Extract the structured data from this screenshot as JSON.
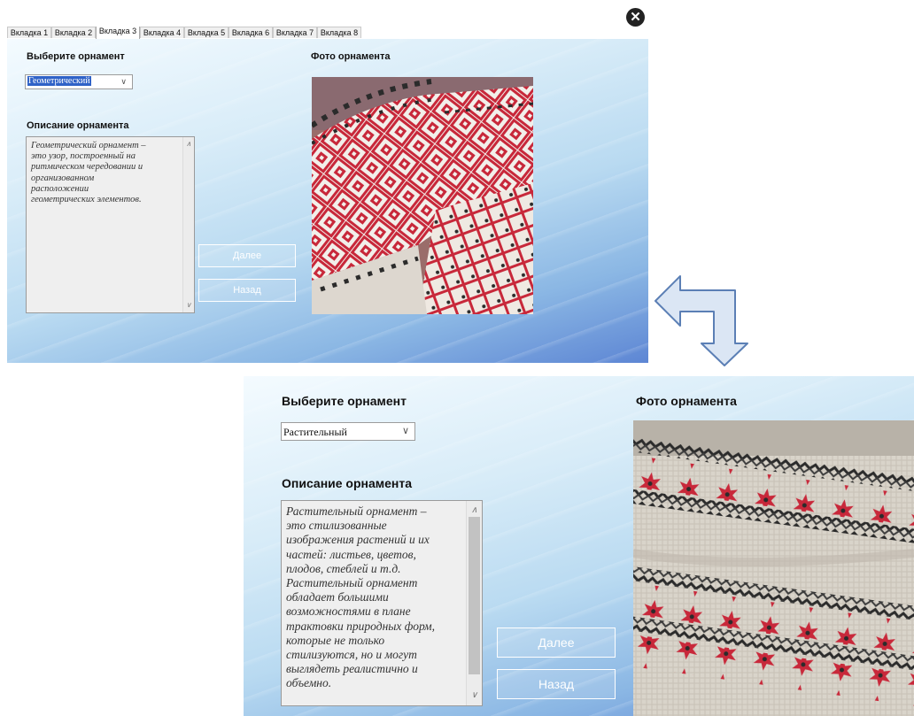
{
  "top_window": {
    "tabs": [
      "Вкладка 1",
      "Вкладка 2",
      "Вкладка 3",
      "Вкладка 4",
      "Вкладка 5",
      "Вкладка 6",
      "Вкладка 7",
      "Вкладка 8"
    ],
    "active_tab": 2,
    "select_label": "Выберите орнамент",
    "combo_value": "Геометрический",
    "description_label": "Описание орнамента",
    "description_lines": [
      "Геометрический орнамент –",
      "это узор, построенный на",
      "ритмическом чередовании и",
      "организованном",
      "расположении",
      "геометрических элементов."
    ],
    "photo_label": "Фото орнамента",
    "next_button": "Далее",
    "back_button": "Назад"
  },
  "bottom_window": {
    "select_label": "Выберите орнамент",
    "combo_value": "Растительный",
    "description_label": "Описание орнамента",
    "description_lines": [
      "Растительный орнамент –",
      "это стилизованные",
      "изображения растений и их",
      "частей: листьев, цветов,",
      "плодов, стеблей и т.д.",
      "Растительный орнамент",
      "обладает большими",
      "возможностями в плане",
      "трактовки природных форм,",
      "которые не только",
      "стилизуются, но и могут",
      "выглядеть реалистично и",
      "объемно."
    ],
    "photo_label": "Фото орнамента",
    "next_button": "Далее",
    "back_button": "Назад"
  },
  "icons": {
    "close": "close-icon",
    "combo_arrow": "chevron-down-icon",
    "transition": "transition-arrow-icon"
  },
  "colors": {
    "ornament_red": "#c8283a",
    "ornament_dark": "#2b2b2b",
    "linen": "#dcd8cf",
    "arrow_fill": "#dbe6f4",
    "arrow_stroke": "#5b7fb5"
  }
}
